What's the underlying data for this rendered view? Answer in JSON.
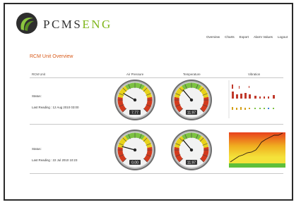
{
  "logo": {
    "part1": "PCMS",
    "part2": "ENG"
  },
  "nav": [
    "Overview",
    "Charts",
    "Export",
    "Alarm Values",
    "Logout"
  ],
  "page_title": "RCM Unit Overview",
  "columns": [
    "RCM Unit",
    "Air Pressure",
    "Temperature",
    "Vibration"
  ],
  "rows": [
    {
      "status_label": "Status:",
      "last_reading": "Last Reading : 12 Aug 2010 03:00",
      "air_pressure": "7.77",
      "temperature": "11.97"
    },
    {
      "status_label": "Status:",
      "last_reading": "Last Reading : 22 Jul 2010 10:23",
      "air_pressure": "0.00",
      "temperature": "11.97"
    }
  ],
  "colors": {
    "accent": "#d85a1a",
    "brand_green": "#7fb61a",
    "gauge_red": "#d23a1e",
    "gauge_yellow": "#e8d21a",
    "gauge_green": "#7cc242"
  }
}
